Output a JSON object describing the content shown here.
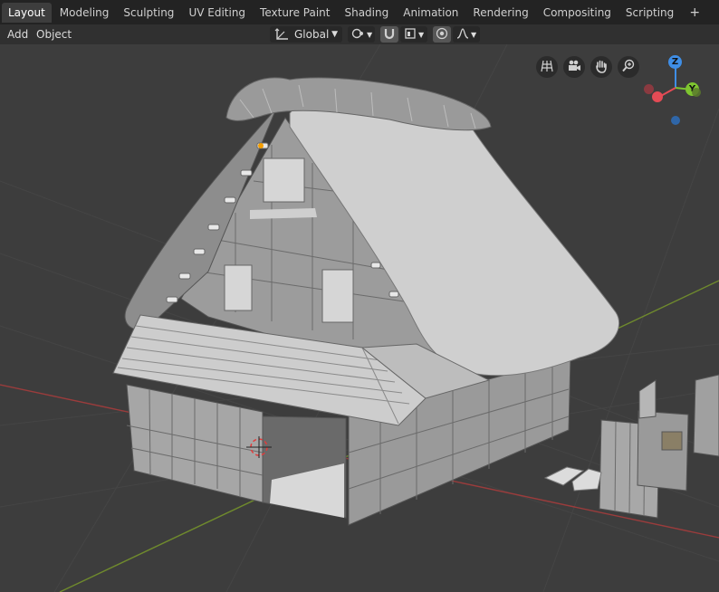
{
  "workspace_tabs": [
    {
      "label": "Layout",
      "active": true
    },
    {
      "label": "Modeling"
    },
    {
      "label": "Sculpting"
    },
    {
      "label": "UV Editing"
    },
    {
      "label": "Texture Paint"
    },
    {
      "label": "Shading"
    },
    {
      "label": "Animation"
    },
    {
      "label": "Rendering"
    },
    {
      "label": "Compositing"
    },
    {
      "label": "Scripting"
    }
  ],
  "add_tab_symbol": "+",
  "header": {
    "add_menu": "Add",
    "object_menu": "Object",
    "transform_orientation": "Global"
  },
  "gizmo": {
    "x": "X",
    "y": "Y",
    "z": "Z"
  },
  "viewport_icons": [
    "grid-view-icon",
    "camera-icon",
    "hand-pan-icon",
    "zoom-icon"
  ],
  "colors": {
    "background": "#3d3d3d",
    "topbar": "#232323",
    "header": "#303030",
    "x_axis_line": "#9a3c3c",
    "y_axis_line": "#6f8a2d",
    "gizmo_x": "#e44b55",
    "gizmo_y": "#7ec530",
    "gizmo_z": "#3f8ee6",
    "active_object_origin": "#f59e00"
  }
}
